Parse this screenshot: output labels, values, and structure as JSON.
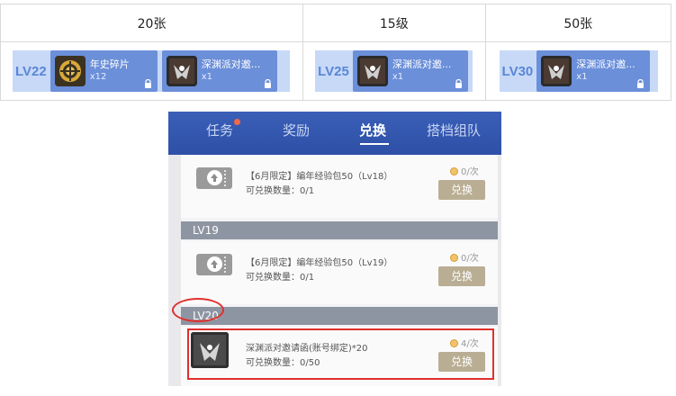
{
  "table": {
    "headers": [
      "20张",
      "15级",
      "50张"
    ],
    "rewards": [
      {
        "level": "LV22",
        "items": [
          {
            "name": "年史碎片",
            "qty": "x12",
            "icon": "gold-emblem-icon"
          },
          {
            "name": "深渊派对邀...",
            "qty": "x1",
            "icon": "abyss-invite-icon"
          }
        ]
      },
      {
        "level": "LV25",
        "items": [
          {
            "name": "深渊派对邀...",
            "qty": "x1",
            "icon": "abyss-invite-icon"
          }
        ]
      },
      {
        "level": "LV30",
        "items": [
          {
            "name": "深渊派对邀...",
            "qty": "x1",
            "icon": "abyss-invite-icon"
          }
        ]
      }
    ]
  },
  "game": {
    "tabs": [
      {
        "label": "任务",
        "badge": true
      },
      {
        "label": "奖励",
        "badge": false
      },
      {
        "label": "兑换",
        "badge": false,
        "active": true
      },
      {
        "label": "搭档组队",
        "badge": false
      }
    ],
    "entries": [
      {
        "name": "【6月限定】编年经验包50（Lv18）",
        "count": "可兑换数量：0/1",
        "limit": "0/次",
        "button": "兑换"
      },
      {
        "section": "LV19"
      },
      {
        "name": "【6月限定】编年经验包50（Lv19）",
        "count": "可兑换数量：0/1",
        "limit": "0/次",
        "button": "兑换"
      },
      {
        "section": "LV20"
      },
      {
        "name": "深渊派对邀请函(账号绑定)*20",
        "count": "可兑换数量：0/50",
        "limit": "4/次",
        "button": "兑换"
      }
    ]
  },
  "colors": {
    "strip": "#c7d9f7",
    "card": "#6b8fd9",
    "tab_bar": "#3a5fb8",
    "annotation": "#e0302e"
  }
}
